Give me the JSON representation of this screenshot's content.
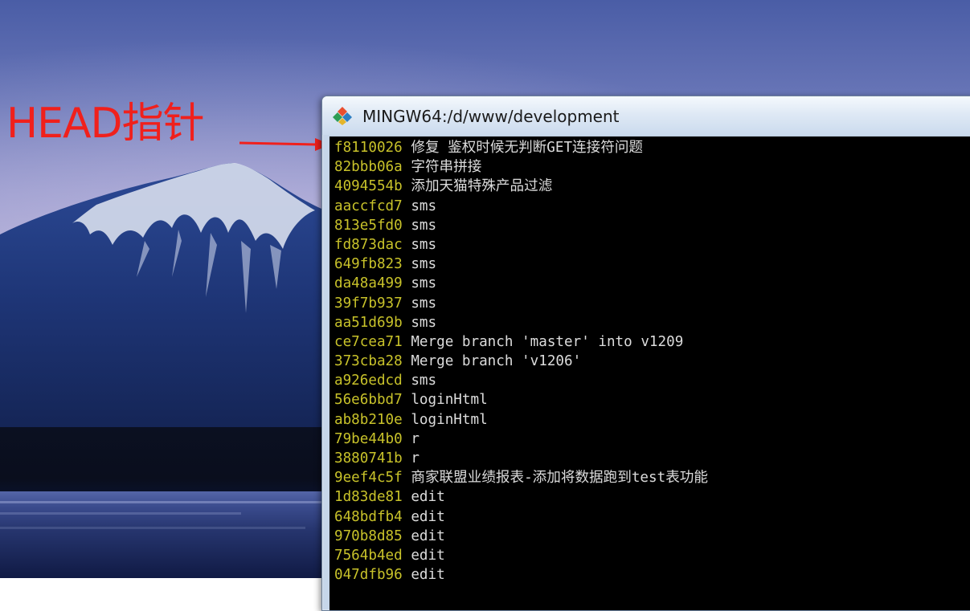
{
  "annotation": {
    "label": "HEAD指针",
    "color": "#f0201c"
  },
  "window": {
    "title": "MINGW64:/d/www/development",
    "icon": "git-icon"
  },
  "colors": {
    "hash": "#c8c22a",
    "message": "#dcdcdc",
    "console_bg": "#000000"
  },
  "log": [
    {
      "hash": "f8110026",
      "message": "修复 鉴权时候无判断GET连接符问题"
    },
    {
      "hash": "82bbb06a",
      "message": "字符串拼接"
    },
    {
      "hash": "4094554b",
      "message": "添加天猫特殊产品过滤"
    },
    {
      "hash": "aaccfcd7",
      "message": "sms"
    },
    {
      "hash": "813e5fd0",
      "message": "sms"
    },
    {
      "hash": "fd873dac",
      "message": "sms"
    },
    {
      "hash": "649fb823",
      "message": "sms"
    },
    {
      "hash": "da48a499",
      "message": "sms"
    },
    {
      "hash": "39f7b937",
      "message": "sms"
    },
    {
      "hash": "aa51d69b",
      "message": "sms"
    },
    {
      "hash": "ce7cea71",
      "message": "Merge branch 'master' into v1209"
    },
    {
      "hash": "373cba28",
      "message": "Merge branch 'v1206'"
    },
    {
      "hash": "a926edcd",
      "message": "sms"
    },
    {
      "hash": "56e6bbd7",
      "message": "loginHtml"
    },
    {
      "hash": "ab8b210e",
      "message": "loginHtml"
    },
    {
      "hash": "79be44b0",
      "message": "r"
    },
    {
      "hash": "3880741b",
      "message": "r"
    },
    {
      "hash": "9eef4c5f",
      "message": "商家联盟业绩报表-添加将数据跑到test表功能"
    },
    {
      "hash": "1d83de81",
      "message": "edit"
    },
    {
      "hash": "648bdfb4",
      "message": "edit"
    },
    {
      "hash": "970b8d85",
      "message": "edit"
    },
    {
      "hash": "7564b4ed",
      "message": "edit"
    },
    {
      "hash": "047dfb96",
      "message": "edit"
    }
  ]
}
